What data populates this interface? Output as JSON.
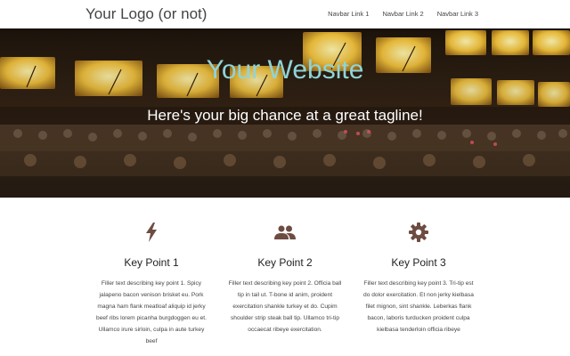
{
  "navbar": {
    "logo": "Your Logo (or not)",
    "links": [
      "Navbar Link 1",
      "Navbar Link 2",
      "Navbar Link 3"
    ]
  },
  "hero": {
    "title": "Your Website",
    "tagline": "Here's your big chance at a great tagline!"
  },
  "features": [
    {
      "icon": "lightning-bolt-icon",
      "title": "Key Point 1",
      "text": "Filler text describing key point 1. Spicy jalapeno bacon venison brisket eu. Pork magna ham flank meatloaf aliquip id jerky beef ribs lorem picanha burgdoggen eu et. Ullamco irure sirloin, culpa in aute turkey beef"
    },
    {
      "icon": "group-icon",
      "title": "Key Point 2",
      "text": "Filler text describing key point 2. Officia ball tip in tail ut. T-bone id anim, proident exercitation shankle turkey et do. Cupim shoulder strip steak ball tip. Ullamco tri-tip occaecat ribeye exercitation."
    },
    {
      "icon": "gear-icon",
      "title": "Key Point 3",
      "text": "Filler text describing key point 3. Tri-tip est do dolor exercitation. Et non jerky kielbasa filet mignon, sint shankle. Leberkas flank bacon, laboris turducken proident culpa kielbasa tenderloin officia ribeye"
    }
  ],
  "colors": {
    "icon": "#6d4c41",
    "hero_title": "#8fd4d8",
    "tagline": "#ffffff"
  }
}
